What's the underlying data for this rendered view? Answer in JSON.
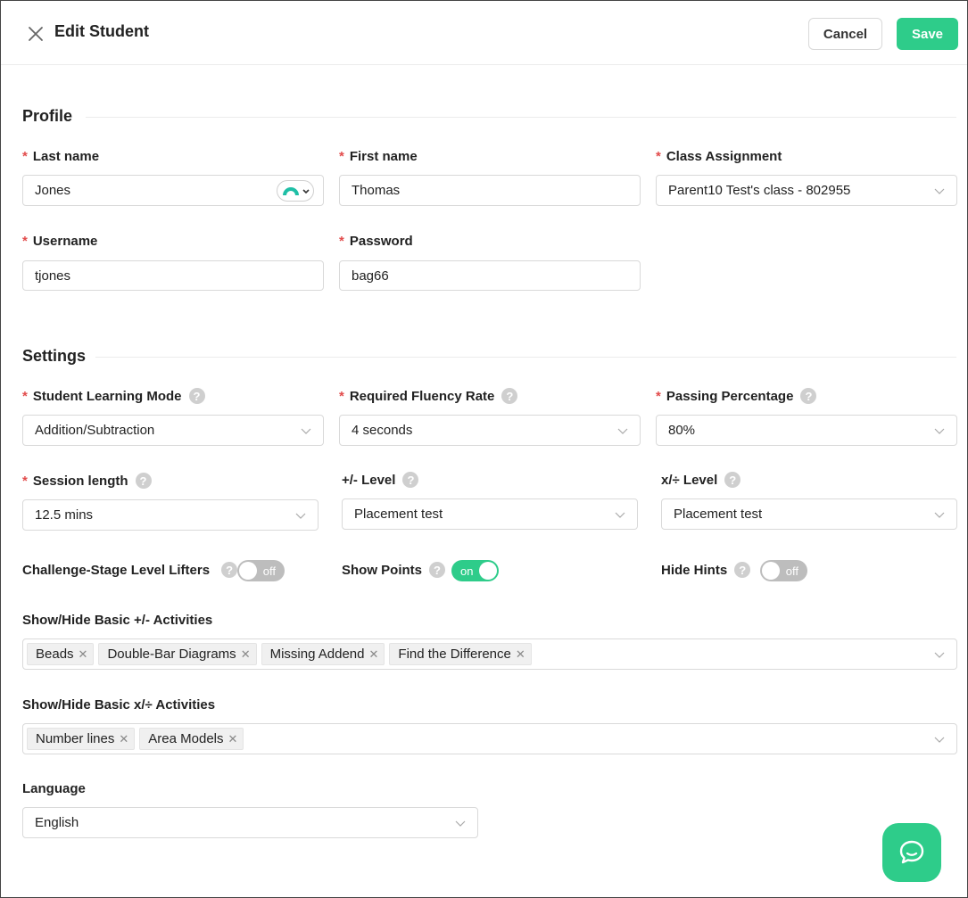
{
  "header": {
    "title": "Edit Student",
    "cancel_label": "Cancel",
    "save_label": "Save"
  },
  "profile": {
    "section_title": "Profile",
    "last_name": {
      "label": "Last name",
      "value": "Jones"
    },
    "first_name": {
      "label": "First name",
      "value": "Thomas"
    },
    "class_assignment": {
      "label": "Class Assignment",
      "value": "Parent10 Test's class - 802955"
    },
    "username": {
      "label": "Username",
      "value": "tjones"
    },
    "password": {
      "label": "Password",
      "value": "bag66"
    }
  },
  "settings": {
    "section_title": "Settings",
    "learning_mode": {
      "label": "Student Learning Mode",
      "value": "Addition/Subtraction"
    },
    "fluency_rate": {
      "label": "Required Fluency Rate",
      "value": "4 seconds"
    },
    "passing_percentage": {
      "label": "Passing Percentage",
      "value": "80%"
    },
    "session_length": {
      "label": "Session length",
      "value": "12.5 mins"
    },
    "addsub_level": {
      "label": "+/- Level",
      "value": "Placement test"
    },
    "muldiv_level": {
      "label": "x/÷ Level",
      "value": "Placement test"
    },
    "challenge_lifters": {
      "label": "Challenge-Stage Level Lifters",
      "state": "off"
    },
    "show_points": {
      "label": "Show Points",
      "state": "on"
    },
    "hide_hints": {
      "label": "Hide Hints",
      "state": "off"
    },
    "addsub_activities": {
      "label": "Show/Hide Basic +/- Activities",
      "tags": [
        "Beads",
        "Double-Bar Diagrams",
        "Missing Addend",
        "Find the Difference"
      ]
    },
    "muldiv_activities": {
      "label": "Show/Hide Basic x/÷ Activities",
      "tags": [
        "Number lines",
        "Area Models"
      ]
    },
    "language": {
      "label": "Language",
      "value": "English"
    }
  },
  "icons": {
    "close": "close-icon",
    "help": "?",
    "chevron": "chevron-down-icon",
    "chat": "chat-bubble-icon",
    "password_manager": "password-manager-icon"
  },
  "colors": {
    "accent": "#2ecc8a",
    "required": "#e24b4b",
    "toggle_off": "#bdbdbd"
  }
}
